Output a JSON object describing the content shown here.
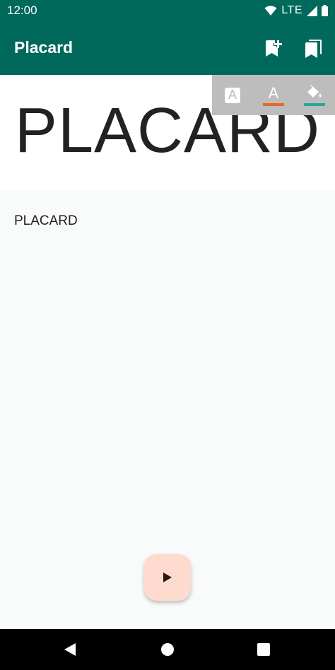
{
  "status_bar": {
    "time": "12:00",
    "network": "LTE",
    "icons": [
      "wifi-icon",
      "cell-signal-icon",
      "battery-icon"
    ]
  },
  "app_bar": {
    "title": "Placard",
    "actions": [
      {
        "name": "bookmark-add-icon",
        "label": "Add bookmark"
      },
      {
        "name": "bookmarks-icon",
        "label": "Bookmarks"
      }
    ],
    "color": "#00695c"
  },
  "preview": {
    "text": "PLACARD",
    "background_color": "#ffffff",
    "text_color": "#222222"
  },
  "format_toolbar": {
    "buttons": [
      {
        "name": "background-text-icon",
        "glyph": "A"
      },
      {
        "name": "text-color-icon",
        "glyph": "A",
        "underline_color": "#e4682b"
      },
      {
        "name": "fill-color-icon",
        "underline_color": "#26a69a"
      }
    ],
    "background": "#bdbdbd"
  },
  "editor": {
    "text": "PLACARD"
  },
  "fab": {
    "icon": "play-icon",
    "color": "#ffdbcf"
  },
  "nav_bar": {
    "buttons": [
      "back-icon",
      "home-icon",
      "recents-icon"
    ]
  }
}
